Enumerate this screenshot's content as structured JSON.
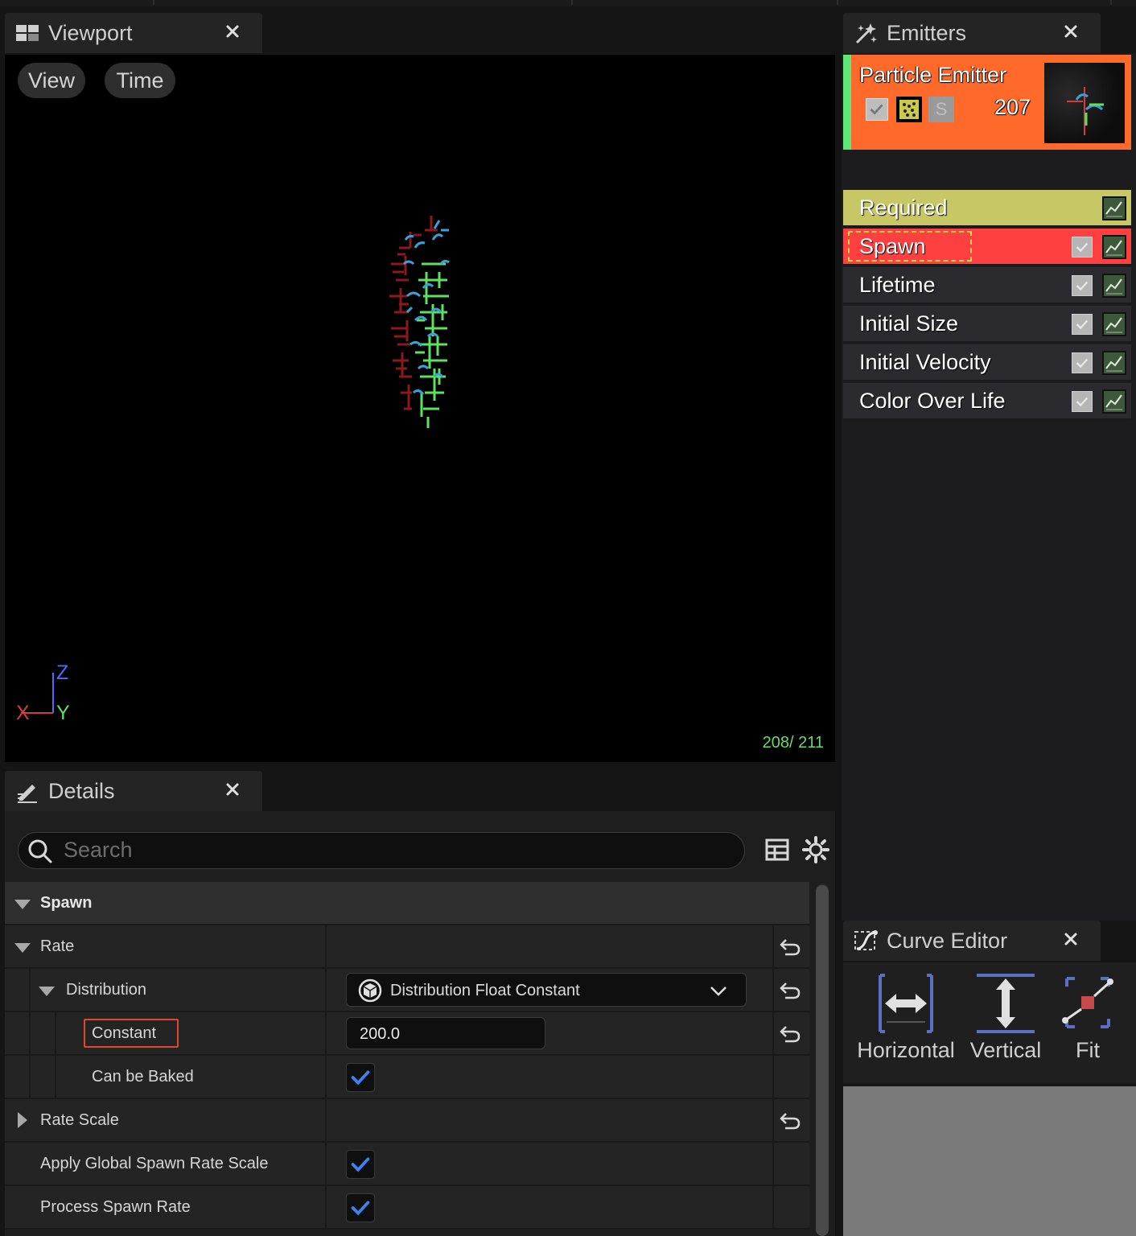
{
  "tabs": {
    "viewport": {
      "title": "Viewport",
      "icon": "viewport-layout-icon"
    },
    "emitters": {
      "title": "Emitters",
      "icon": "sparkle-icon"
    },
    "details": {
      "title": "Details",
      "icon": "pencil-edit-icon"
    },
    "curve_editor": {
      "title": "Curve Editor",
      "icon": "curve-icon"
    },
    "close_icon": "close-icon"
  },
  "viewport": {
    "buttons": {
      "view": "View",
      "time": "Time"
    },
    "axes": {
      "z": "Z",
      "x": "X",
      "y": "Y"
    },
    "frame_counter": "208/ 211",
    "colors": {
      "x": "#d63c3c",
      "y": "#5fe15f",
      "z": "#4a6cff"
    }
  },
  "emitters": {
    "emitter": {
      "name": "Particle Emitter",
      "count": "207",
      "solo_badge": "S",
      "colors": {
        "card": "#ff6a2b",
        "accent": "#5fe87a"
      }
    },
    "modules": [
      {
        "label": "Required",
        "color": "#c8c766",
        "has_checkbox": false
      },
      {
        "label": "Spawn",
        "color": "#ff4040",
        "has_checkbox": true,
        "selected": true
      },
      {
        "label": "Lifetime",
        "color": "#2b2b2f",
        "has_checkbox": true
      },
      {
        "label": "Initial Size",
        "color": "#2b2b2f",
        "has_checkbox": true
      },
      {
        "label": "Initial Velocity",
        "color": "#2b2b2f",
        "has_checkbox": true
      },
      {
        "label": "Color Over Life",
        "color": "#2b2b2f",
        "has_checkbox": true
      }
    ]
  },
  "details": {
    "search": {
      "placeholder": "Search"
    },
    "rows": {
      "spawn": {
        "label": "Spawn"
      },
      "rate": {
        "label": "Rate"
      },
      "distribution": {
        "label": "Distribution",
        "value": "Distribution Float Constant"
      },
      "constant": {
        "label": "Constant",
        "value": "200.0"
      },
      "can_be_baked": {
        "label": "Can be Baked",
        "checked": true
      },
      "rate_scale": {
        "label": "Rate Scale"
      },
      "apply_global": {
        "label": "Apply Global Spawn Rate Scale",
        "checked": true
      },
      "process_spawn": {
        "label": "Process Spawn Rate",
        "checked": true
      }
    },
    "colors": {
      "check": "#3b82f6",
      "highlight": "#e0472d"
    }
  },
  "curve_editor": {
    "buttons": {
      "horizontal": "Horizontal",
      "vertical": "Vertical",
      "fit": "Fit"
    }
  }
}
